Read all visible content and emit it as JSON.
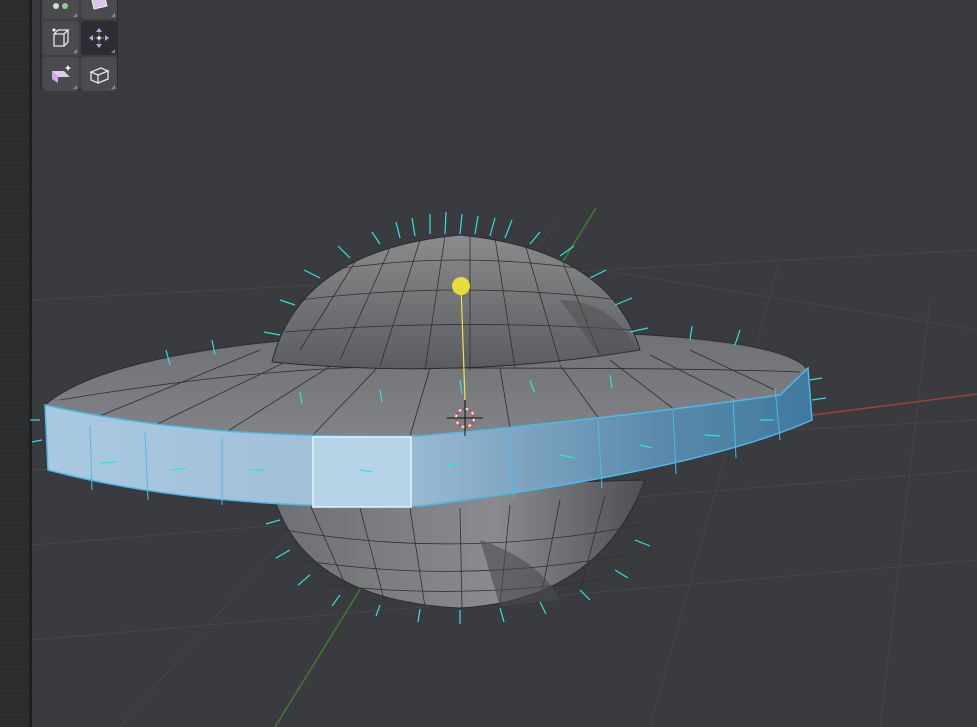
{
  "viewport": {
    "mode": "edit-mesh",
    "object": "saucer-mesh",
    "selection": "outer-rim-faces",
    "normals_overlay": true,
    "colors": {
      "background": "#3a3b3e",
      "selection": "#4fb8e8",
      "normals": "#2ee0e6",
      "x_axis": "#b04545",
      "y_axis": "#4a8a3a",
      "light": "#f0e24a"
    }
  },
  "toolbar": {
    "tools": [
      {
        "icon": "select-box-icon",
        "active": false
      },
      {
        "icon": "inset-icon",
        "active": false
      },
      {
        "icon": "extrude-icon",
        "active": false
      },
      {
        "icon": "move-icon",
        "active": true
      },
      {
        "icon": "bevel-icon",
        "active": false
      },
      {
        "icon": "loop-cut-icon",
        "active": false
      }
    ]
  }
}
